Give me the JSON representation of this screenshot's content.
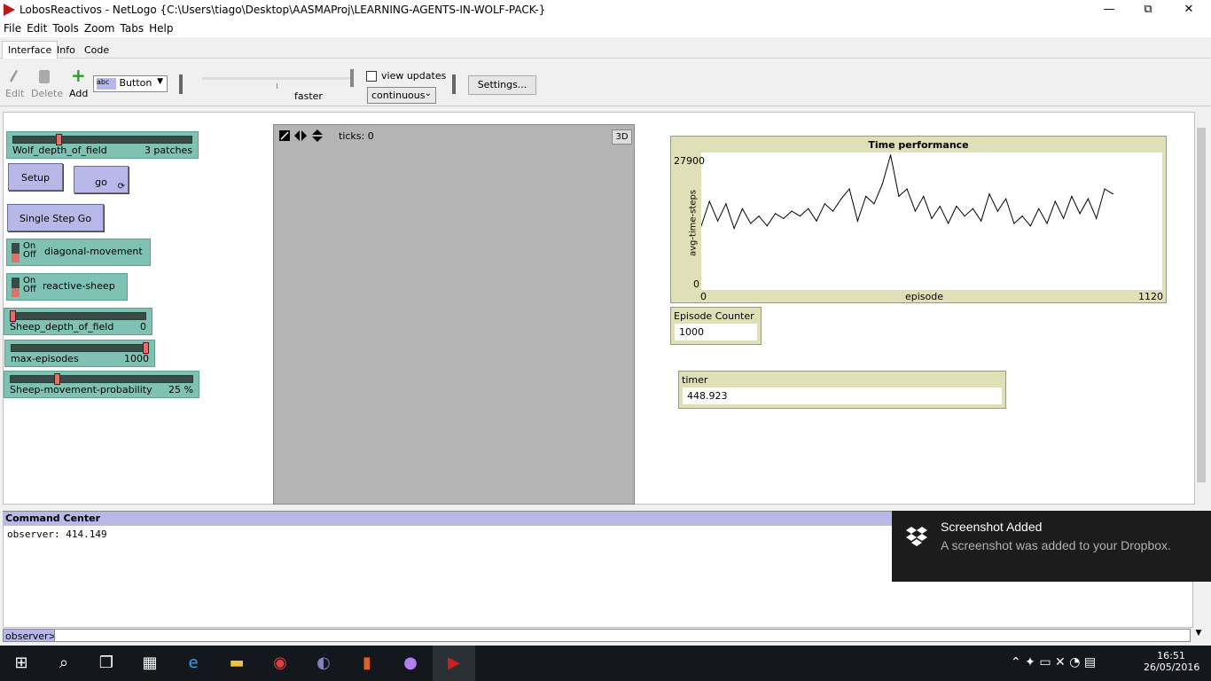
{
  "window": {
    "title": "LobosReactivos - NetLogo {C:\\Users\\tiago\\Desktop\\AASMAProj\\LEARNING-AGENTS-IN-WOLF-PACK-}",
    "controls": [
      "—",
      "⧉",
      "✕"
    ]
  },
  "menu": [
    "File",
    "Edit",
    "Tools",
    "Zoom",
    "Tabs",
    "Help"
  ],
  "tabs": [
    "Interface",
    "Info",
    "Code"
  ],
  "toolbar": {
    "edit": "Edit",
    "delete": "Delete",
    "add": "Add",
    "widget_type": "Button",
    "widget_icon": "abc",
    "speed_label": "faster",
    "view_updates": "view updates",
    "update_mode": "continuous",
    "settings": "Settings..."
  },
  "widgets": {
    "wolf_depth": {
      "label": "Wolf_depth_of_field",
      "value": "3 patches",
      "level": 0.25
    },
    "setup": "Setup",
    "go": "go",
    "single_step": "Single Step Go",
    "diagonal": {
      "label": "diagonal-movement",
      "on": "On",
      "off": "Off"
    },
    "reactive": {
      "label": "reactive-sheep",
      "on": "On",
      "off": "Off"
    },
    "sheep_depth": {
      "label": "Sheep_depth_of_field",
      "value": "0",
      "level": 0.0
    },
    "max_episodes": {
      "label": "max-episodes",
      "value": "1000",
      "level": 1.0
    },
    "sheep_prob": {
      "label": "Sheep-movement-probability",
      "value": "25 %",
      "level": 0.25
    }
  },
  "view": {
    "ticks": "ticks: 0",
    "btn3d": "3D"
  },
  "plot": {
    "title": "Time performance",
    "ylabel": "avg-time-steps",
    "xlabel": "episode",
    "ymax": "27900",
    "ymin": "0",
    "xmin": "0",
    "xmax": "1120"
  },
  "chart_data": {
    "type": "line",
    "title": "Time performance",
    "xlabel": "episode",
    "ylabel": "avg-time-steps",
    "xlim": [
      0,
      1120
    ],
    "ylim": [
      0,
      27900
    ],
    "series": [
      {
        "name": "",
        "x": [
          0,
          20,
          40,
          60,
          80,
          100,
          120,
          140,
          160,
          180,
          200,
          220,
          240,
          260,
          280,
          300,
          320,
          340,
          360,
          380,
          400,
          420,
          440,
          460,
          480,
          500,
          520,
          540,
          560,
          580,
          600,
          620,
          640,
          660,
          680,
          700,
          720,
          740,
          760,
          780,
          800,
          820,
          840,
          860,
          880,
          900,
          920,
          940,
          960,
          980,
          1000
        ],
        "y": [
          13000,
          18000,
          14000,
          17500,
          12500,
          16500,
          13500,
          15000,
          13000,
          15500,
          14500,
          16000,
          15000,
          16500,
          14000,
          17500,
          16000,
          18500,
          20500,
          14000,
          19000,
          17500,
          21500,
          27400,
          19000,
          20500,
          16000,
          19000,
          14500,
          17000,
          13500,
          17000,
          15000,
          16500,
          14000,
          19500,
          16000,
          18500,
          13500,
          15000,
          13000,
          16500,
          13500,
          18000,
          14500,
          19000,
          15500,
          18500,
          14500,
          20500,
          19500
        ]
      }
    ]
  },
  "monitors": {
    "episode_counter": {
      "label": "Episode Counter",
      "value": "1000"
    },
    "timer": {
      "label": "timer",
      "value": "448.923"
    }
  },
  "command_center": {
    "title": "Command Center",
    "output": "observer: 414.149",
    "prompt": "observer>"
  },
  "toast": {
    "title": "Screenshot Added",
    "body": "A screenshot was added to your Dropbox."
  },
  "taskbar": {
    "time": "16:51",
    "date": "26/05/2016"
  }
}
